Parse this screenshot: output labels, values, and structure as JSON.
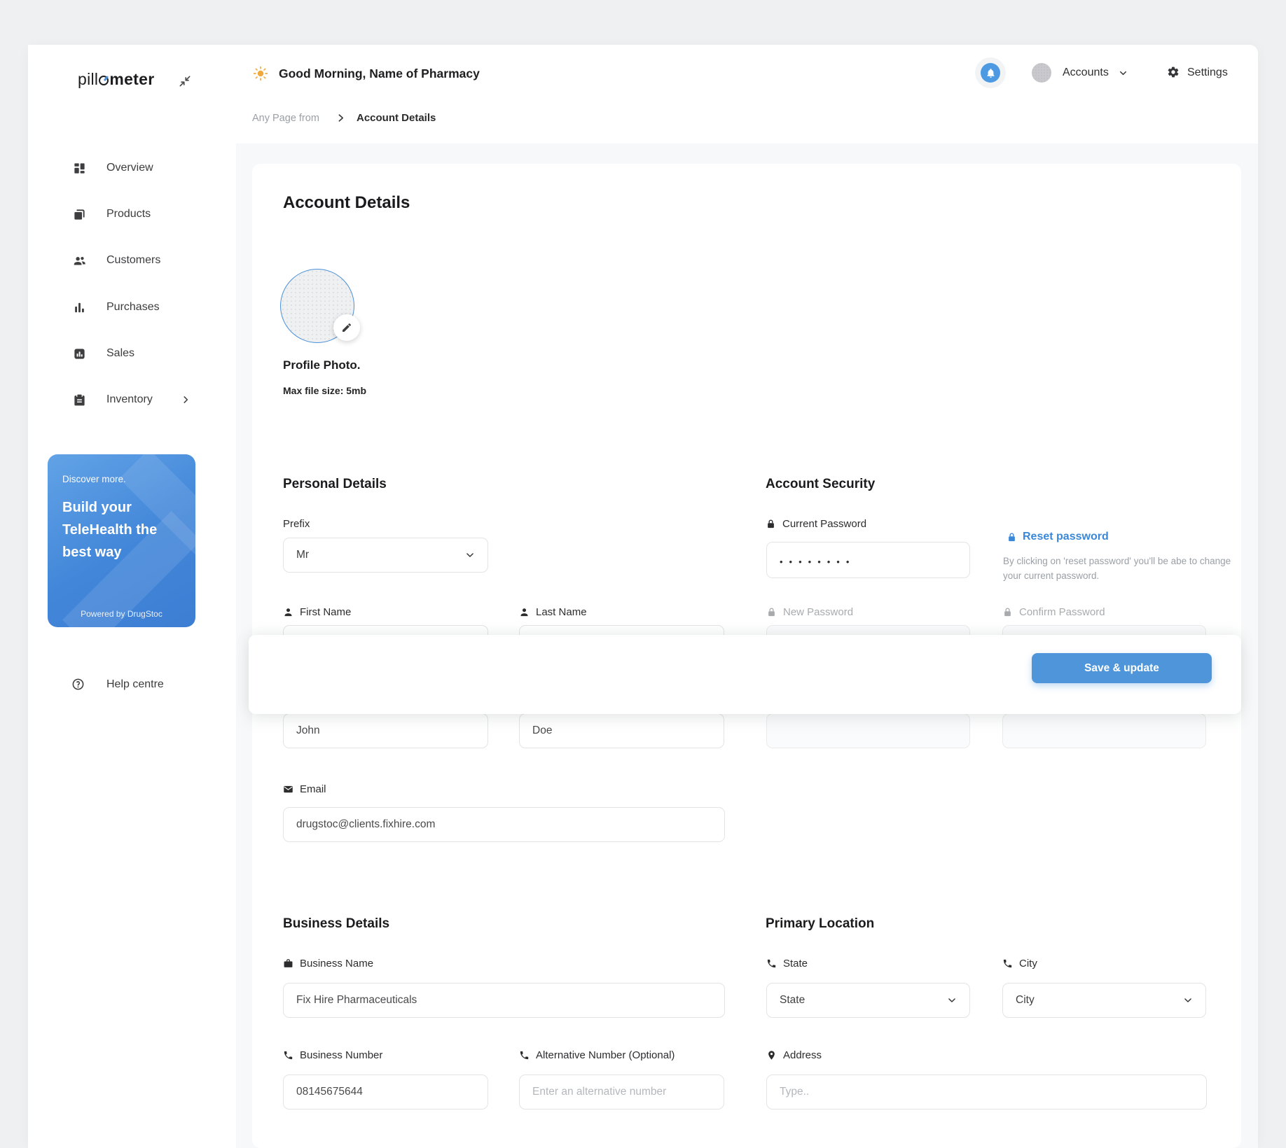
{
  "app": {
    "logo_prefix": "pill",
    "logo_suffix": "meter"
  },
  "header": {
    "greeting": "Good Morning, Name of Pharmacy",
    "accounts_label": "Accounts",
    "settings_label": "Settings"
  },
  "breadcrumb": {
    "parent": "Any Page from",
    "current": "Account Details"
  },
  "sidebar": {
    "items": [
      {
        "label": "Overview"
      },
      {
        "label": "Products"
      },
      {
        "label": "Customers"
      },
      {
        "label": "Purchases"
      },
      {
        "label": "Sales"
      },
      {
        "label": "Inventory"
      }
    ],
    "promo": {
      "eyebrow": "Discover more.",
      "title": "Build your TeleHealth the best way",
      "footer": "Powered by DrugStoc"
    },
    "help_label": "Help centre"
  },
  "page": {
    "title": "Account Details",
    "profile": {
      "label": "Profile Photo.",
      "hint": "Max file size: 5mb"
    },
    "personal": {
      "heading": "Personal Details",
      "prefix_label": "Prefix",
      "prefix_value": "Mr",
      "first_name_label": "First Name",
      "first_name_value": "John",
      "last_name_label": "Last Name",
      "last_name_value": "Doe",
      "email_label": "Email",
      "email_value": "drugstoc@clients.fixhire.com"
    },
    "security": {
      "heading": "Account Security",
      "current_password_label": "Current Password",
      "current_password_mask": "••••••••",
      "reset_link": "Reset password",
      "reset_hint": "By clicking on 'reset password' you'll be abe to change your current password.",
      "new_password_label": "New Password",
      "confirm_password_label": "Confirm Password"
    },
    "save_button": "Save & update",
    "business": {
      "heading": "Business Details",
      "name_label": "Business Name",
      "name_value": "Fix Hire Pharmaceuticals",
      "number_label": "Business Number",
      "number_value": "08145675644",
      "alt_label": "Alternative Number (Optional)",
      "alt_placeholder": "Enter an alternative number"
    },
    "location": {
      "heading": "Primary Location",
      "state_label": "State",
      "state_value": "State",
      "city_label": "City",
      "city_value": "City",
      "address_label": "Address",
      "address_placeholder": "Type.."
    }
  },
  "colors": {
    "accent": "#4E96D9",
    "link_blue": "#3B87D8",
    "bell_blue": "#4D9AE2",
    "sun_orange": "#F2A93B",
    "avatar_ring_blue": "#4A90D9",
    "promo_gradient_start": "#62A3E6",
    "promo_gradient_end": "#3D7ED3"
  }
}
